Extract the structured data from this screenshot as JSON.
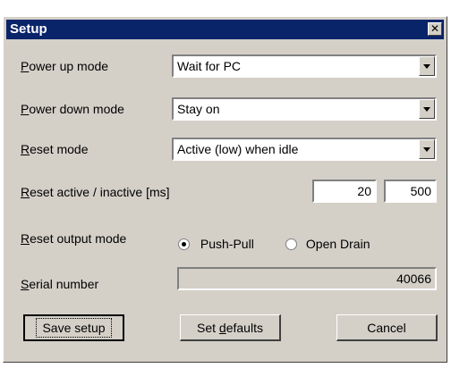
{
  "window": {
    "title": "Setup"
  },
  "power_up_mode": {
    "label_accel": "P",
    "label_rest": "ower up mode",
    "value": "Wait for PC"
  },
  "power_down_mode": {
    "label_accel": "P",
    "label_rest": "ower down mode",
    "value": "Stay on"
  },
  "reset_mode": {
    "label_accel": "R",
    "label_rest": "eset mode",
    "value": "Active (low) when idle"
  },
  "reset_timing": {
    "label_accel": "R",
    "label_rest": "eset active / inactive [ms]",
    "active_value": "20",
    "inactive_value": "500"
  },
  "reset_output_mode": {
    "label_accel": "R",
    "label_rest": "eset output mode",
    "options": [
      {
        "label": "Push-Pull",
        "checked": true
      },
      {
        "label_accel": "O",
        "label_rest": "pen Drain",
        "checked": false
      }
    ]
  },
  "serial_number": {
    "label_accel": "S",
    "label_rest": "erial number",
    "value": "40066"
  },
  "buttons": {
    "save": "Save setup",
    "defaults_prefix": "Set ",
    "defaults_accel": "d",
    "defaults_rest": "efaults",
    "cancel": "Cancel"
  }
}
